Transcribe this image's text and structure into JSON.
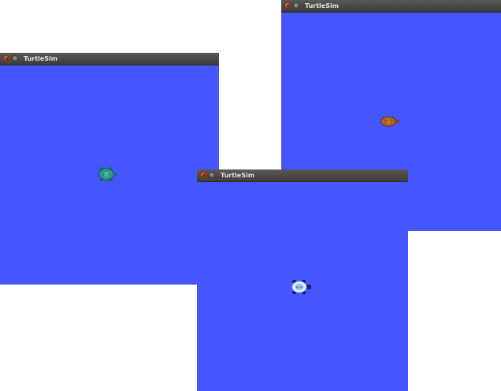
{
  "windows": [
    {
      "title": "TurtleSim",
      "turtle": "turtle-shell-orange-icon"
    },
    {
      "title": "TurtleSim",
      "turtle": "turtle-shell-teal-icon"
    },
    {
      "title": "TurtleSim",
      "turtle": "turtle-shell-white-blue-icon"
    }
  ],
  "colors": {
    "canvas_background": "#4556ff",
    "titlebar": "#3d3c38",
    "desktop": "#ffffff",
    "close_button": "#e2572c"
  }
}
